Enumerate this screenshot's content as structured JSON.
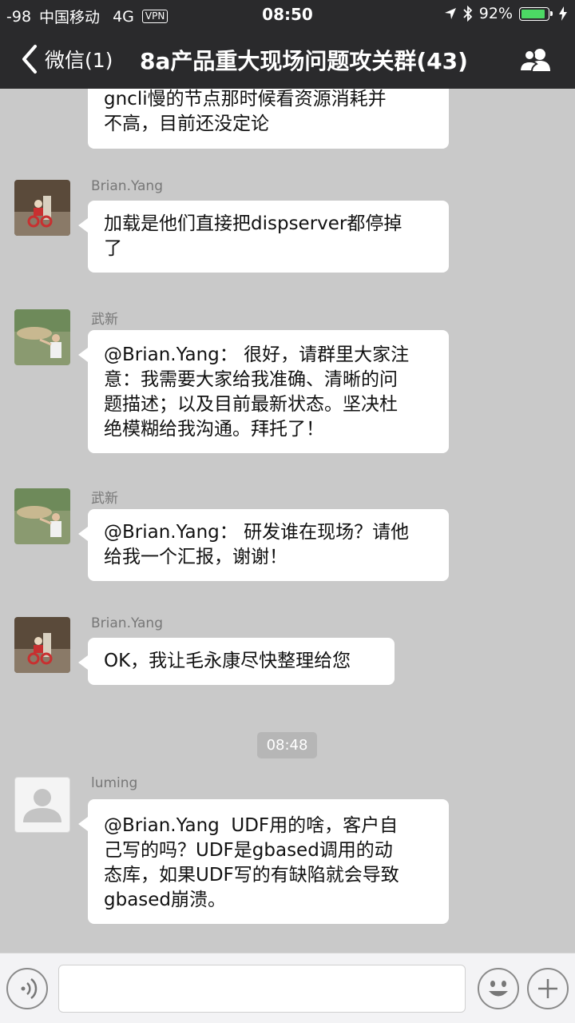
{
  "status_bar": {
    "signal": "-98",
    "carrier": "中国移动",
    "network": "4G",
    "vpn": "VPN",
    "time": "08:50",
    "battery": "92%",
    "battery_level": 0.92
  },
  "nav": {
    "back_label": "微信(1)",
    "title": "8a产品重大现场问题攻关群(43)"
  },
  "messages": [
    {
      "sender": "",
      "text": "gncli慢的节点那时候看资源消耗并\n不高，目前还没定论"
    },
    {
      "sender": "Brian.Yang",
      "text": "加载是他们直接把dispserver都停掉\n了"
    },
    {
      "sender": "武新",
      "text": "@Brian.Yang： 很好，请群里大家注\n意：我需要大家给我准确、清晰的问\n题描述；以及目前最新状态。坚决杜\n绝模糊给我沟通。拜托了！"
    },
    {
      "sender": "武新",
      "text": "@Brian.Yang： 研发谁在现场？请他\n给我一个汇报，谢谢！"
    },
    {
      "sender": "Brian.Yang",
      "text": "OK，我让毛永康尽快整理给您"
    },
    {
      "sender": "luming",
      "text": "@Brian.Yang  UDF用的啥，客户自\n己写的吗？UDF是gbased调用的动\n态库，如果UDF写的有缺陷就会导致\ngbased崩溃。"
    }
  ],
  "timestamp": "08:48",
  "input": {
    "voice_icon": "voice-icon",
    "emoji_icon": "emoji-icon",
    "plus_icon": "plus-icon"
  }
}
